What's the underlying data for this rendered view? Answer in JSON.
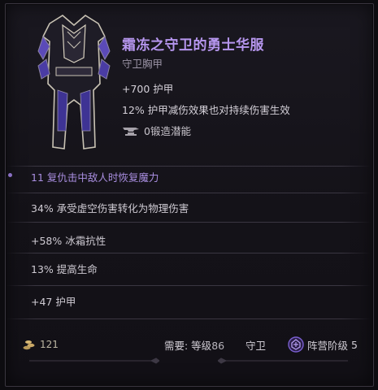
{
  "item": {
    "name": "霜冻之守卫的勇士华服",
    "type": "守卫胸甲",
    "stats": [
      "+700 护甲",
      "12% 护甲减伤效果也对持续伤害生效"
    ],
    "forging_potential": "0锻造潜能"
  },
  "affixes": [
    {
      "text": "11 复仇击中敌人时恢复魔力",
      "special": true
    },
    {
      "text": "34% 承受虚空伤害转化为物理伤害",
      "special": false
    },
    {
      "text": "+58% 冰霜抗性",
      "special": false
    },
    {
      "text": "13% 提高生命",
      "special": false
    },
    {
      "text": "+47 护甲",
      "special": false
    }
  ],
  "footer": {
    "gold": "121",
    "requirement_label": "需要: 等级",
    "requirement_level": "86",
    "class": "守卫",
    "faction_label": "阵营阶级",
    "faction_rank": "5"
  },
  "colors": {
    "title": "#b696ee",
    "special_affix": "#a98ee0",
    "background": "#141218"
  }
}
